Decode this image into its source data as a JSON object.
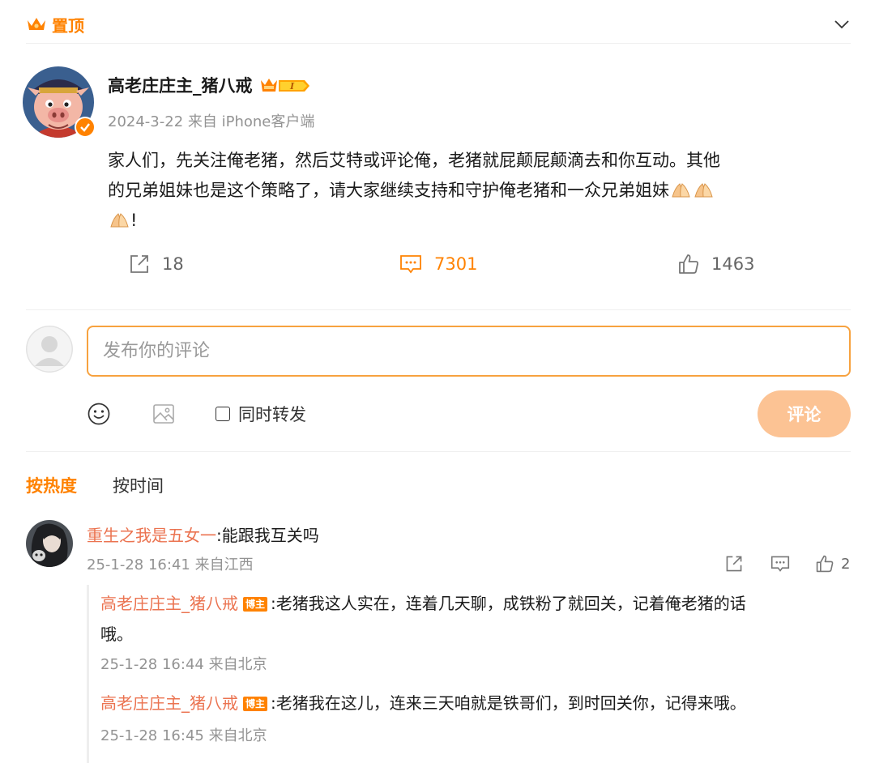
{
  "pinned": {
    "label": "置顶"
  },
  "post": {
    "author": "高老庄庄主_猪八戒",
    "meta": "2024-3-22 来自 iPhone客户端",
    "body_line1": "家人们，先关注俺老猪，然后艾特或评论俺，老猪就屁颠屁颠滴去和你互动。其他",
    "body_line2": "的兄弟姐妹也是这个策略了，请大家继续支持和守护俺老猪和一众兄弟姐妹",
    "body_tail": "!",
    "emoji_name": "pray-hands-emoji"
  },
  "actions": {
    "forward_count": "18",
    "comment_count": "7301",
    "like_count": "1463"
  },
  "composer": {
    "placeholder": "发布你的评论",
    "forward_label": "同时转发",
    "submit_label": "评论"
  },
  "sort": {
    "hot_label": "按热度",
    "time_label": "按时间"
  },
  "comment": {
    "user": "重生之我是五女一",
    "text": ":能跟我互关吗",
    "meta": "25-1-28 16:41 来自江西",
    "like_count": "2",
    "replies": [
      {
        "user": "高老庄庄主_猪八戒",
        "tag": "博主",
        "text_line1": ":老猪我这人实在，连着几天聊，成铁粉了就回关，记着俺老猪的话",
        "text_line2": "哦。",
        "meta": "25-1-28 16:44 来自北京"
      },
      {
        "user": "高老庄庄主_猪八戒",
        "tag": "博主",
        "text_line1": ":老猪我在这儿，连来三天咱就是铁哥们，到时回关你，记得来哦。",
        "meta": "25-1-28 16:45 来自北京"
      }
    ]
  },
  "colors": {
    "accent": "#ff8200",
    "username": "#eb7350",
    "submit_disabled": "#fcc394"
  }
}
